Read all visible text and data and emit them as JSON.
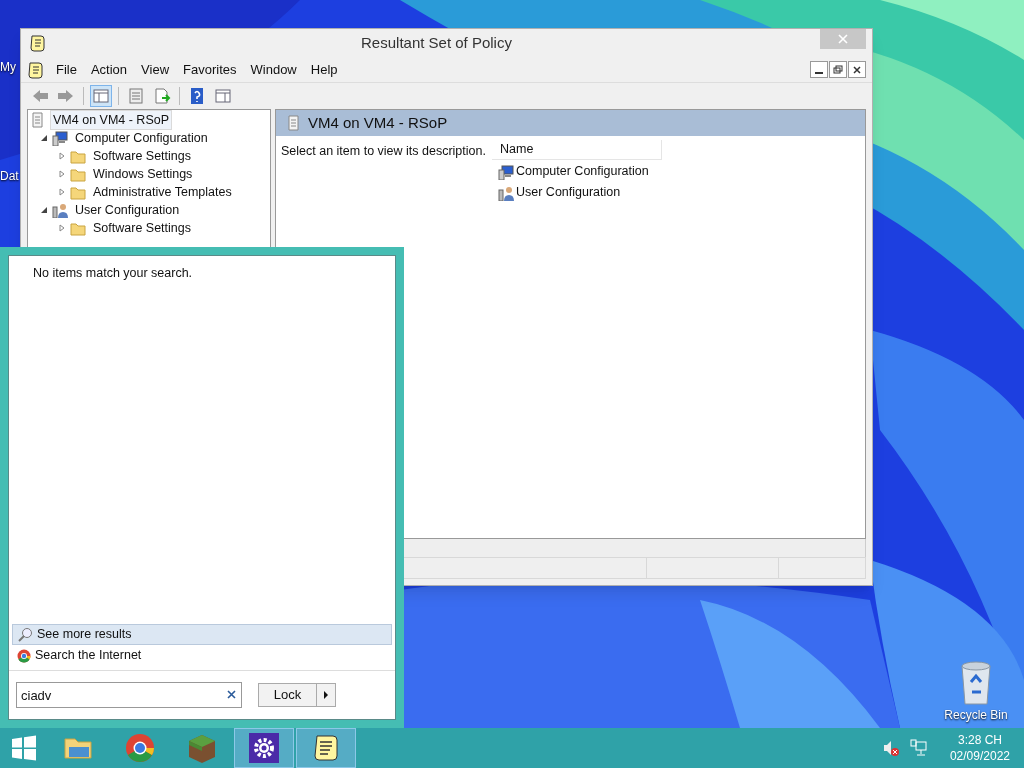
{
  "desktop_icons": [
    {
      "label": "My"
    },
    {
      "label": "Dat"
    },
    {
      "label": "Recycle Bin"
    }
  ],
  "window": {
    "title": "Resultant Set of Policy",
    "menu": [
      "File",
      "Action",
      "View",
      "Favorites",
      "Window",
      "Help"
    ],
    "tree": [
      {
        "label": "VM4 on VM4 - RSoP",
        "selected": true,
        "children": [
          {
            "label": "Computer Configuration",
            "selected": false,
            "expanded": true,
            "children": [
              {
                "label": "Software Settings",
                "selected": false,
                "expanded": false
              },
              {
                "label": "Windows Settings",
                "selected": false,
                "expanded": false
              },
              {
                "label": "Administrative Templates",
                "selected": false,
                "expanded": false
              }
            ]
          },
          {
            "label": "User Configuration",
            "selected": false,
            "expanded": true,
            "children": [
              {
                "label": "Software Settings",
                "selected": false,
                "expanded": false
              }
            ]
          }
        ]
      }
    ],
    "header": "VM4 on VM4 - RSoP",
    "description": "Select an item to view its description.",
    "column": "Name",
    "items": [
      {
        "kind": "computer",
        "label": "Computer Configuration"
      },
      {
        "kind": "user",
        "label": "User Configuration"
      }
    ]
  },
  "start_menu": {
    "message": "No items match your search.",
    "results": [
      {
        "kind": "search",
        "label": "See more results",
        "selected": true
      },
      {
        "kind": "browser",
        "label": "Search the Internet",
        "selected": false
      }
    ],
    "search": {
      "value": "ciadv"
    },
    "power_button": "Lock"
  },
  "taskbar": {
    "apps": [
      {
        "kind": "explorer",
        "active": false
      },
      {
        "kind": "browser",
        "active": false
      },
      {
        "kind": "game",
        "active": false
      },
      {
        "kind": "settings",
        "active": true
      },
      {
        "kind": "policy",
        "active": true
      }
    ],
    "time": "3:28 CH",
    "date": "02/09/2022"
  }
}
